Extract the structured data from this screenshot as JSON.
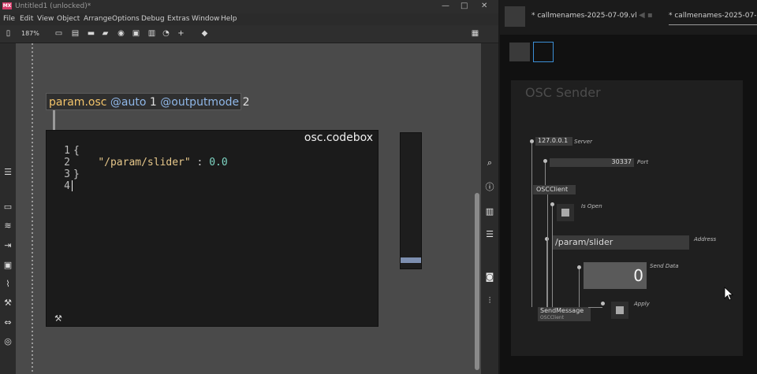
{
  "max": {
    "title": "Untitled1 (unlocked)*",
    "logo": "MX",
    "menu": [
      "File",
      "Edit",
      "View",
      "Object",
      "Arrange",
      "Options",
      "Debug",
      "Extras",
      "Window",
      "Help"
    ],
    "zoom": "187%",
    "toolbar_icons": [
      "sidebar-toggle-icon",
      "zoom-menu-icon",
      "comment-icon",
      "message-icon",
      "speech-icon",
      "button-icon",
      "toggle-icon",
      "number-icon",
      "dial-icon",
      "plus-icon",
      "fill-icon",
      "grid-icon"
    ],
    "left_icons": [
      "list-icon",
      "slider-h-icon",
      "wave-icon",
      "step-icon",
      "image-icon",
      "paperclip-icon",
      "hammer-icon",
      "arrows-icon",
      "target-icon"
    ],
    "right_icons": [
      "search-icon",
      "info-icon",
      "book-icon",
      "list-icon",
      "camera-icon",
      "mixer-icon"
    ],
    "param_object": {
      "name": "param.osc",
      "attr1": "@auto",
      "val1": "1",
      "attr2": "@outputmode",
      "val2": "2"
    },
    "codebox": {
      "title": "osc.codebox",
      "lines": [
        {
          "num": "1",
          "text": "{"
        },
        {
          "num": "2",
          "indent": "    ",
          "key": "\"/param/slider\"",
          "sep": " : ",
          "value": "0.0"
        },
        {
          "num": "3",
          "text": "}"
        },
        {
          "num": "4",
          "text": ""
        }
      ]
    },
    "slider_value": 0.04
  },
  "vvvv": {
    "tab1": "* callmenames-2025-07-09.vl",
    "tab2": "* callmenames-2025-07-09",
    "panel_title": "OSC Sender",
    "server": {
      "value": "127.0.0.1",
      "label": "Server"
    },
    "port": {
      "value": "30337",
      "label": "Port"
    },
    "client_node": "OSCClient",
    "is_open_label": "Is Open",
    "address": {
      "value": "/param/slider",
      "label": "Address"
    },
    "send_data": {
      "value": "0",
      "label": "Send Data"
    },
    "send_message": {
      "name": "SendMessage",
      "sub": "OSCClient"
    },
    "apply_label": "Apply"
  }
}
